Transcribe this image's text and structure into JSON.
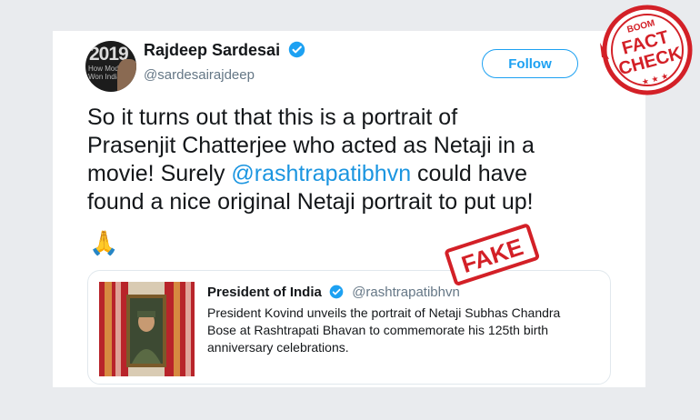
{
  "tweet": {
    "author_name": "Rajdeep Sardesai",
    "author_handle": "@sardesairajdeep",
    "avatar_text": "2019",
    "avatar_subtext": "How Modi Won India",
    "follow_label": "Follow",
    "lines": [
      "So it turns out that this is a portrait of",
      "Prasenjit Chatterjee who acted as Netaji in a",
      "movie! Surely "
    ],
    "mention": "@rashtrapatibhvn",
    "line3_tail": " could have",
    "line4": "found a nice original Netaji portrait to put up!",
    "emoji": "🙏"
  },
  "quoted_tweet": {
    "author_name": "President of India",
    "author_handle": "@rashtrapatibhvn",
    "text": "President Kovind unveils the portrait of Netaji Subhas Chandra Bose at Rashtrapati Bhavan to commemorate his 125th birth anniversary celebrations."
  },
  "stamps": {
    "fake": "FAKE",
    "badge_brand": "BOOM",
    "badge_line1": "FACT",
    "badge_line2": "CHECK"
  },
  "colors": {
    "accent": "#1da1f2",
    "mention": "#1b95e0",
    "stamp_red": "#d32027"
  },
  "icons": [
    "verified-badge-icon",
    "folded-hands-emoji"
  ]
}
